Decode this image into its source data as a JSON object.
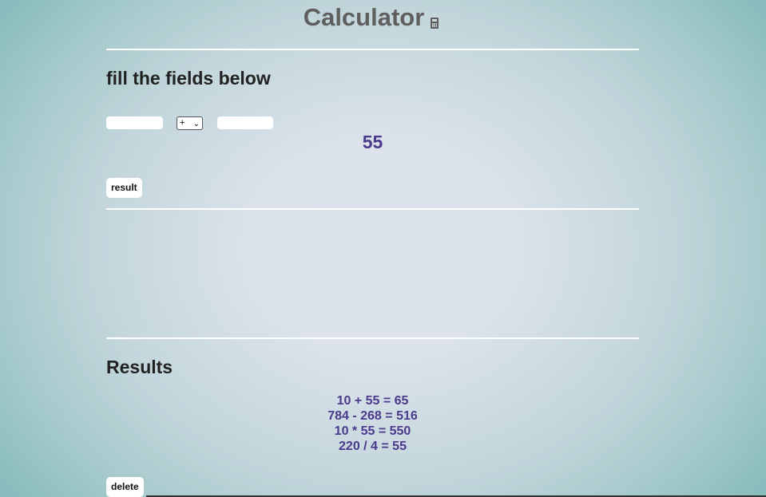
{
  "header": {
    "title": "Calculator",
    "icon": "calculator-icon"
  },
  "form": {
    "heading": "fill the fields below",
    "first_operand": "",
    "operator_selected": "+",
    "operator_options": [
      "+",
      "-",
      "*",
      "/"
    ],
    "second_operand": "",
    "result": "55",
    "result_button_label": "result"
  },
  "results": {
    "heading": "Results",
    "history": [
      "10 + 55 = 65",
      "784 - 268 = 516",
      "10 * 55 = 550",
      "220 / 4 = 55"
    ],
    "delete_button_label": "delete"
  },
  "colors": {
    "accent": "#4b3a8c",
    "title": "#5f5f5f",
    "heading": "#222222"
  }
}
